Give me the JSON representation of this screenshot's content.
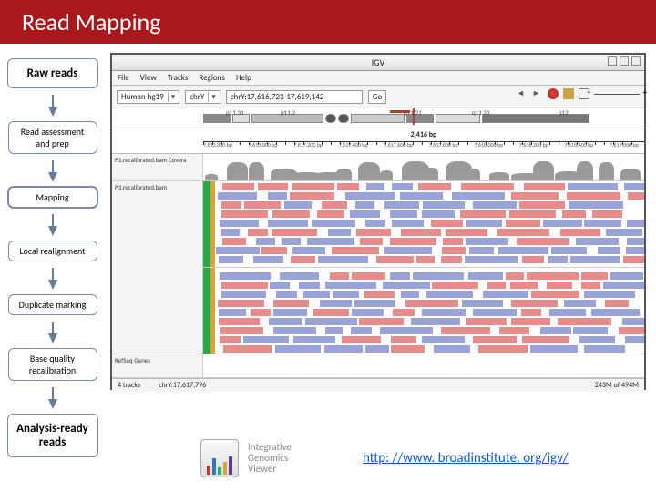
{
  "title": "Read Mapping",
  "flow": {
    "raw": "Raw reads",
    "assess": "Read assessment and prep",
    "mapping": "Mapping",
    "realign": "Local realignment",
    "dup": "Duplicate marking",
    "bq": "Base quality recalibration",
    "ready": "Analysis-ready reads"
  },
  "igv": {
    "window_title": "IGV",
    "menu": {
      "file": "File",
      "view": "View",
      "tracks": "Tracks",
      "regions": "Regions",
      "help": "Help"
    },
    "genome": "Human hg19",
    "chrom": "chrY",
    "locus": "chrY:17,616,723-17,619,142",
    "go": "Go",
    "ideogram": {
      "p1131": "p11.31",
      "p112": "p11.2",
      "q1121": "q11.21",
      "q112": "q11.23",
      "q12": "q12"
    },
    "ruler_bp": "2,416 bp",
    "ticks": [
      "7,612,800 bp",
      "7,613,000 bp",
      "7,617,200 bp",
      "7,617,400 bp",
      "7,617,600 bp",
      "7,617,800 bp",
      "7,618,000 bp",
      "7,618,200 bp",
      "7,618,400 bp",
      "7,619,000 bp"
    ],
    "track_cov": "P3.recalibrated.bam Covera",
    "track_aln": "P3.recalibrated.bam",
    "track_refseq": "RefSeq Genes",
    "status_left": "4 tracks",
    "status_mid": "chrY:17,617,796",
    "status_right": "243M of 494M"
  },
  "logo": {
    "line1": "Integrative",
    "line2": "Genomics",
    "line3": "Viewer"
  },
  "link": "http: //www. broadinstitute. org/igv/"
}
